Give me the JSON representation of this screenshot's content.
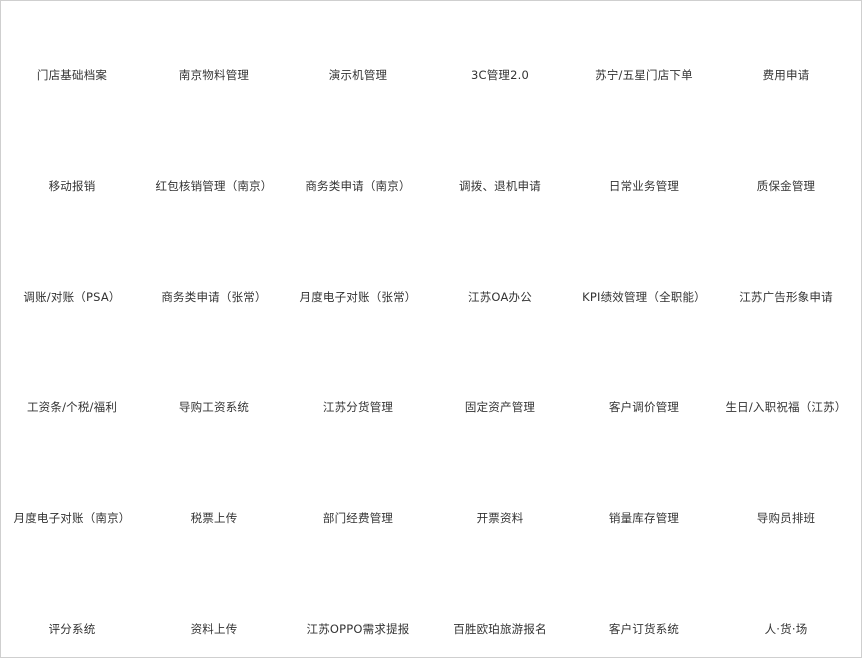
{
  "accent": "#0d6b3a",
  "tiles": [
    {
      "label": "门店基础档案",
      "icon": "org-tree-icon"
    },
    {
      "label": "南京物料管理",
      "icon": "binders-icon"
    },
    {
      "label": "演示机管理",
      "icon": "phone-icon"
    },
    {
      "label": "3C管理2.0",
      "icon": "presentation-icon"
    },
    {
      "label": "苏宁/五星门店下单",
      "icon": "check-circle-icon"
    },
    {
      "label": "费用申请",
      "icon": "document-check-icon"
    },
    {
      "label": "移动报销",
      "icon": "yuan-box-icon"
    },
    {
      "label": "红包核销管理（南京）",
      "icon": "list-doc-icon"
    },
    {
      "label": "商务类申请（南京）",
      "icon": "checklist-icon"
    },
    {
      "label": "调拨、退机申请",
      "icon": "document-wrench-icon"
    },
    {
      "label": "日常业务管理",
      "icon": "notepad-pen-icon"
    },
    {
      "label": "质保金管理",
      "icon": "safe-icon"
    },
    {
      "label": "调账/对账（PSA）",
      "icon": "printer-icon"
    },
    {
      "label": "商务类申请（张常）",
      "icon": "checklist-icon"
    },
    {
      "label": "月度电子对账（张常）",
      "icon": "yuan-gear-icon"
    },
    {
      "label": "江苏OA办公",
      "icon": "monitor-icon"
    },
    {
      "label": "KPI绩效管理（全职能）",
      "icon": "line-chart-icon"
    },
    {
      "label": "江苏广告形象申请",
      "icon": "building-icon"
    },
    {
      "label": "工资条/个税/福利",
      "icon": "flag-icon"
    },
    {
      "label": "导购工资系统",
      "icon": "house-yuan-icon"
    },
    {
      "label": "江苏分货管理",
      "icon": "calendar-check-icon"
    },
    {
      "label": "固定资产管理",
      "icon": "garage-icon"
    },
    {
      "label": "客户调价管理",
      "icon": "dollar-doc-icon"
    },
    {
      "label": "生日/入职祝福（江苏）",
      "icon": "smiley-icon"
    },
    {
      "label": "月度电子对账（南京）",
      "icon": "yuan-gear-icon"
    },
    {
      "label": "税票上传",
      "icon": "folder-tray-icon"
    },
    {
      "label": "部门经费管理",
      "icon": "yuan-stack-icon"
    },
    {
      "label": "开票资料",
      "icon": "documents-icon"
    },
    {
      "label": "销量库存管理",
      "icon": "pulse-chart-icon"
    },
    {
      "label": "导购员排班",
      "icon": "clipboard-search-icon"
    },
    {
      "label": "评分系统",
      "icon": "monitor-gear-icon"
    },
    {
      "label": "资料上传",
      "icon": "hand-card-icon"
    },
    {
      "label": "江苏OPPO需求提报",
      "icon": "clipboard-check-icon"
    },
    {
      "label": "百胜欧珀旅游报名",
      "icon": "location-pin-icon"
    },
    {
      "label": "客户订货系统",
      "icon": "presenter-icon"
    },
    {
      "label": "人·货·场",
      "icon": "magic-wand-icon"
    }
  ]
}
